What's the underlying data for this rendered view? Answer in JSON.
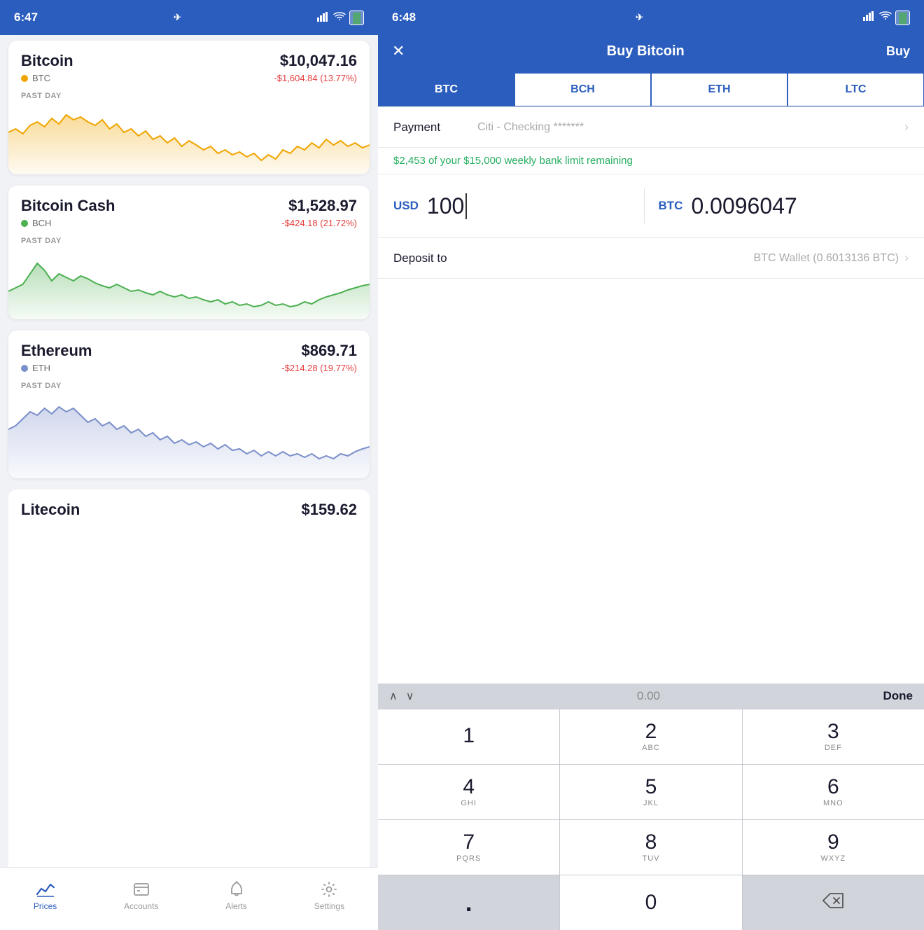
{
  "left": {
    "statusBar": {
      "time": "6:47",
      "locationIcon": "▶",
      "signalIcon": "▐▐▐▐",
      "wifiIcon": "wifi",
      "batteryIcon": "battery"
    },
    "coins": [
      {
        "name": "Bitcoin",
        "ticker": "BTC",
        "dotColor": "#f0a500",
        "price": "$10,047.16",
        "change": "-$1,604.84 (13.77%)",
        "chartColor": "#f0a500",
        "chartFill": "#fef3d0",
        "pastDay": "PAST DAY"
      },
      {
        "name": "Bitcoin Cash",
        "ticker": "BCH",
        "dotColor": "#4caf50",
        "price": "$1,528.97",
        "change": "-$424.18 (21.72%)",
        "chartColor": "#4caf50",
        "chartFill": "#e8f5e9",
        "pastDay": "PAST DAY"
      },
      {
        "name": "Ethereum",
        "ticker": "ETH",
        "dotColor": "#7b8fca",
        "price": "$869.71",
        "change": "-$214.28 (19.77%)",
        "chartColor": "#7b8fca",
        "chartFill": "#eaecf7",
        "pastDay": "PAST DAY"
      }
    ],
    "litecoin": {
      "name": "Litecoin",
      "price": "$159.62"
    },
    "nav": [
      {
        "label": "Prices",
        "active": true,
        "icon": "prices"
      },
      {
        "label": "Accounts",
        "active": false,
        "icon": "accounts"
      },
      {
        "label": "Alerts",
        "active": false,
        "icon": "alerts"
      },
      {
        "label": "Settings",
        "active": false,
        "icon": "settings"
      }
    ]
  },
  "right": {
    "statusBar": {
      "time": "6:48",
      "locationIcon": "▶"
    },
    "header": {
      "closeLabel": "✕",
      "title": "Buy Bitcoin",
      "buyLabel": "Buy"
    },
    "tabs": [
      {
        "label": "BTC",
        "active": true
      },
      {
        "label": "BCH",
        "active": false
      },
      {
        "label": "ETH",
        "active": false
      },
      {
        "label": "LTC",
        "active": false
      }
    ],
    "form": {
      "paymentLabel": "Payment",
      "paymentValue": "Citi - Checking *******",
      "limitText": "$2,453 of your $15,000 weekly bank limit remaining",
      "usdLabel": "USD",
      "usdAmount": "100",
      "btcLabel": "BTC",
      "btcAmount": "0.0096047",
      "depositLabel": "Deposit to",
      "depositValue": "BTC Wallet (0.6013136 BTC)"
    },
    "numpad": {
      "display": "0.00",
      "doneLabel": "Done",
      "keys": [
        {
          "num": "1",
          "sub": ""
        },
        {
          "num": "2",
          "sub": "ABC"
        },
        {
          "num": "3",
          "sub": "DEF"
        },
        {
          "num": "4",
          "sub": "GHI"
        },
        {
          "num": "5",
          "sub": "JKL"
        },
        {
          "num": "6",
          "sub": "MNO"
        },
        {
          "num": "7",
          "sub": "PQRS"
        },
        {
          "num": "8",
          "sub": "TUV"
        },
        {
          "num": "9",
          "sub": "WXYZ"
        },
        {
          "num": ".",
          "sub": ""
        },
        {
          "num": "0",
          "sub": ""
        },
        {
          "num": "⌫",
          "sub": ""
        }
      ]
    }
  }
}
